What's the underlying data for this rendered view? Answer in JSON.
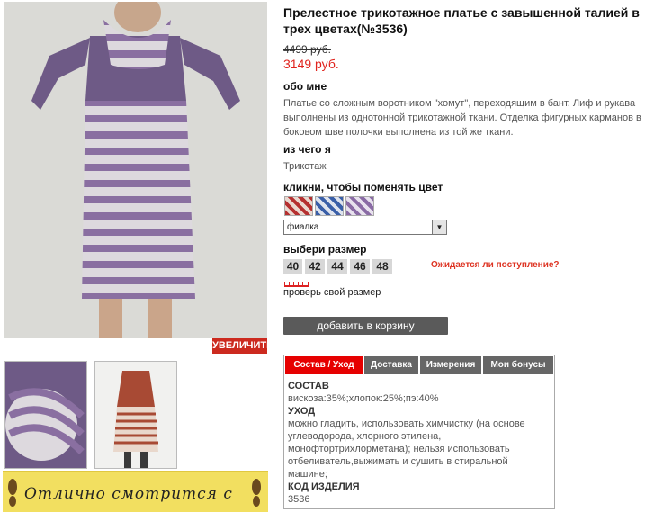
{
  "product": {
    "title": "Прелестное трикотажное платье с завышенной талией в трех цветах(№3536)",
    "old_price": "4499 руб.",
    "new_price": "3149 руб."
  },
  "images": {
    "zoom_label": "УВЕЛИЧИТЬ",
    "banner_text": "Отлично смотрится с"
  },
  "about": {
    "heading": "обо мне",
    "text": "Платье со сложным воротником \"хомут\", переходящим в бант. Лиф и рукава выполнены из однотонной трикотажной ткани. Отделка фигурных карманов в боковом шве полочки выполнена из той же ткани."
  },
  "material": {
    "heading": "из чего я",
    "text": "Трикотаж"
  },
  "color": {
    "heading": "кликни, чтобы поменять цвет",
    "selected": "фиалка",
    "swatches": [
      "red-stripe",
      "blue-stripe",
      "violet-stripe"
    ]
  },
  "size": {
    "heading": "выбери размер",
    "options": [
      "40",
      "42",
      "44",
      "46",
      "48"
    ],
    "notify_link": "Ожидается ли поступление?",
    "check_link": "проверь свой размер"
  },
  "cart": {
    "button": "добавить в корзину"
  },
  "tabs": {
    "items": [
      "Состав / Уход",
      "Доставка",
      "Измерения",
      "Мои бонусы"
    ],
    "active": "Состав / Уход"
  },
  "details": {
    "composition_h": "СОСТАВ",
    "composition": "вискоза:35%;хлопок:25%;пэ:40%",
    "care_h": "УХОД",
    "care": "можно гладить, использовать химчистку (на основе углеводорода, хлорного этилена, монофтортрихлорметана); нельзя использовать отбеливатель,выжимать и сушить в стиральной машине;",
    "code_h": "КОД ИЗДЕЛИЯ",
    "code": "3536"
  },
  "colors": {
    "price_red": "#e0231d",
    "tab_active": "#e60000",
    "tab_inactive": "#666666",
    "zoom_bg": "#cc2a1f",
    "banner_bg": "#f2df60"
  }
}
